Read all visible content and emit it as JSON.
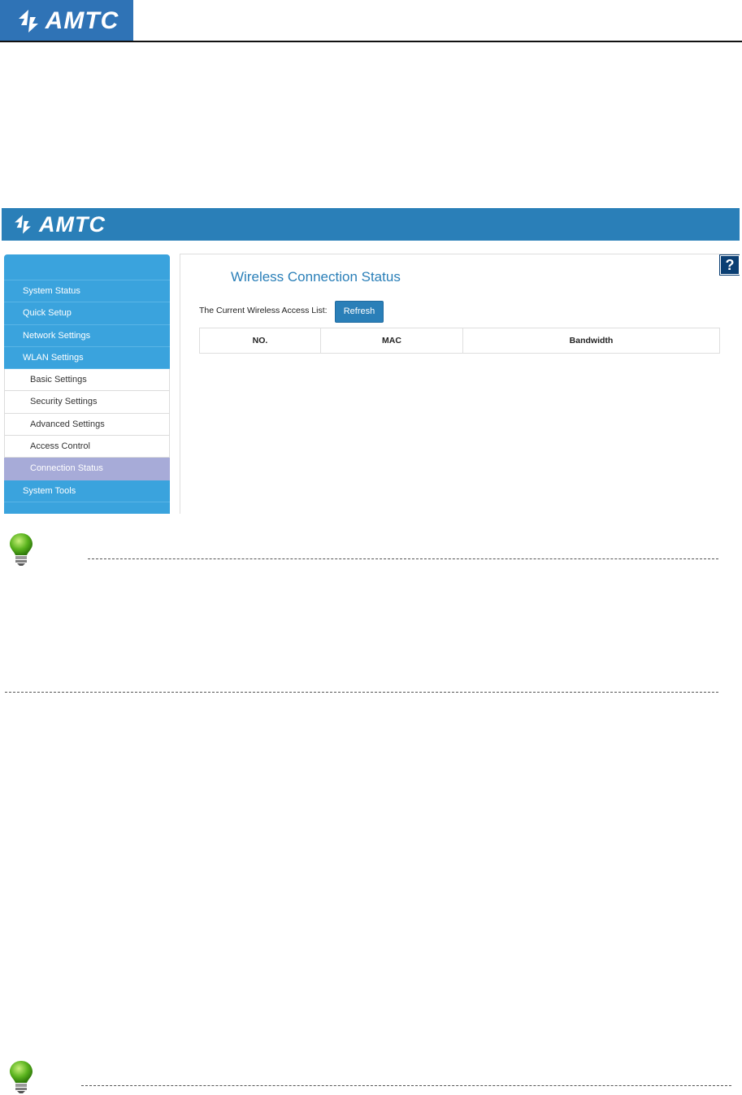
{
  "document": {
    "logo_text": "AMTC"
  },
  "app": {
    "logo_text": "AMTC",
    "help_label": "?",
    "sidebar": {
      "items": [
        {
          "label": "System Status",
          "type": "top"
        },
        {
          "label": "Quick Setup",
          "type": "top"
        },
        {
          "label": "Network Settings",
          "type": "top"
        },
        {
          "label": "WLAN Settings",
          "type": "top"
        },
        {
          "label": "Basic Settings",
          "type": "sub"
        },
        {
          "label": "Security Settings",
          "type": "sub"
        },
        {
          "label": "Advanced Settings",
          "type": "sub"
        },
        {
          "label": "Access Control",
          "type": "sub"
        },
        {
          "label": "Connection Status",
          "type": "sub",
          "active": true
        },
        {
          "label": "System Tools",
          "type": "top"
        }
      ]
    },
    "main": {
      "title": "Wireless Connection Status",
      "list_label": "The Current Wireless Access List:",
      "refresh_label": "Refresh",
      "table": {
        "headers": [
          "NO.",
          "MAC",
          "Bandwidth"
        ]
      }
    }
  },
  "colors": {
    "brand_blue": "#2a7fb8",
    "sidebar_blue": "#3aa3dd",
    "active_item": "#a7abd8",
    "help_navy": "#0b3f73"
  }
}
